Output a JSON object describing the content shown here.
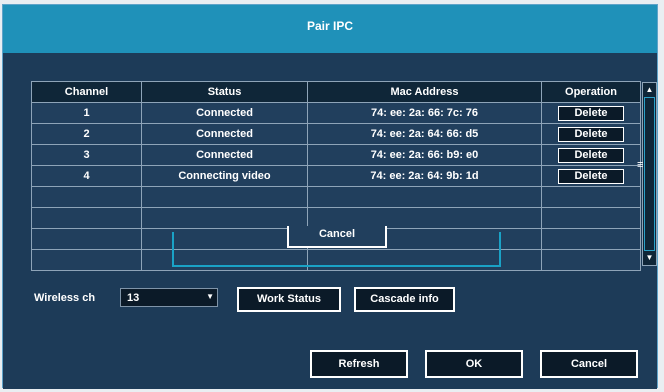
{
  "dialog": {
    "title": "Pair IPC"
  },
  "table": {
    "headers": [
      "Channel",
      "Status",
      "Mac Address",
      "Operation"
    ],
    "rows": [
      {
        "channel": "1",
        "status": "Connected",
        "mac": "74: ee: 2a: 66: 7c: 76",
        "op": "Delete"
      },
      {
        "channel": "2",
        "status": "Connected",
        "mac": "74: ee: 2a: 64: 66: d5",
        "op": "Delete"
      },
      {
        "channel": "3",
        "status": "Connected",
        "mac": "74: ee: 2a: 66: b9: e0",
        "op": "Delete"
      },
      {
        "channel": "4",
        "status": "Connecting video",
        "mac": "74: ee: 2a: 64: 9b: 1d",
        "op": "Delete"
      }
    ],
    "inner_cancel": "Cancel"
  },
  "wireless": {
    "label": "Wireless ch",
    "value": "13"
  },
  "buttons": {
    "work_status": "Work Status",
    "cascade_info": "Cascade info",
    "refresh": "Refresh",
    "ok": "OK",
    "cancel": "Cancel"
  },
  "icons": {
    "scroll_up": "▲",
    "scroll_down": "▼",
    "select_arrow": "▼",
    "grip": "≡"
  },
  "colors": {
    "title_bar": "#1f91b9",
    "body": "#1d3b58",
    "accent": "#1aa2c6"
  }
}
